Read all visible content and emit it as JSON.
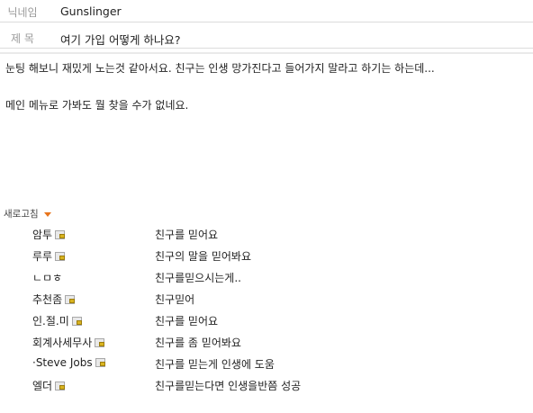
{
  "header": {
    "nickname_label": "닉네임",
    "nickname_value": "Gunslinger",
    "title_label": "제 목",
    "title_value": "여기 가입 어떻게 하나요?"
  },
  "post": {
    "line1": "눈팅 해보니 재밌게 노는것 같아서요. 친구는 인생 망가진다고 들어가지 말라고 하기는 하는데...",
    "line2": "메인 메뉴로 가봐도 뭘 찾을 수가 없네요."
  },
  "refresh_label": "새로고침",
  "members": [
    {
      "name": "암투",
      "message": "친구를 믿어요"
    },
    {
      "name": "루루",
      "message": "친구의 말을 믿어봐요"
    },
    {
      "name": "ㄴㅁㅎ",
      "message": "친구를믿으시는게.."
    },
    {
      "name": "추천좀",
      "message": "친구믿어"
    },
    {
      "name": "인.절.미",
      "message": "친구를 믿어요"
    },
    {
      "name": "회계사세무사",
      "message": "친구를 좀 믿어봐요"
    },
    {
      "name": "·Steve Jobs",
      "message": "친구를 믿는게 인생에 도움"
    },
    {
      "name": "엘더",
      "message": "친구를믿는다면 인생을반쯤 성공"
    }
  ],
  "colors": {
    "accent_triangle": "#e8741c",
    "label_gray": "#9a9a9a"
  }
}
